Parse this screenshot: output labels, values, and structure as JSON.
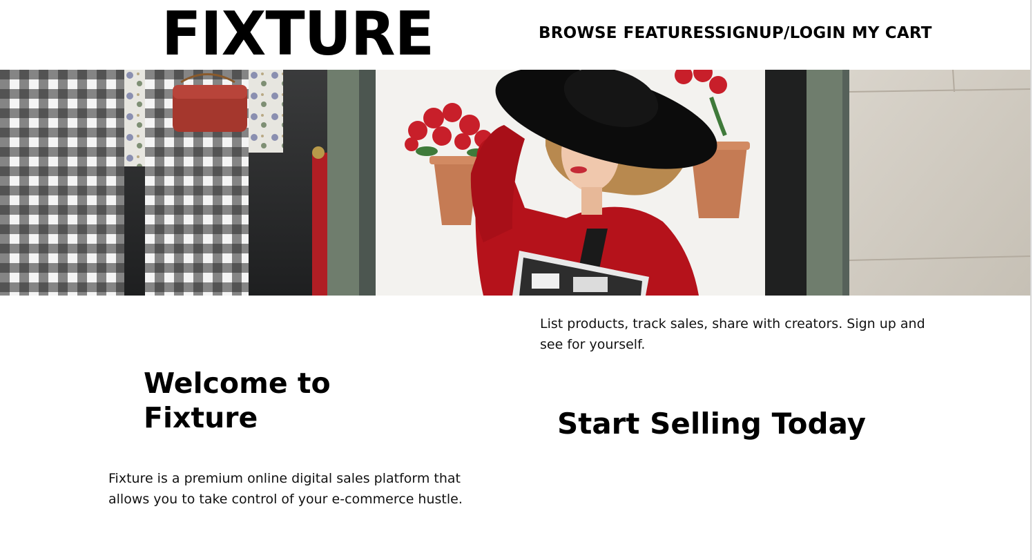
{
  "brand": {
    "logo_text": "FIXTURE"
  },
  "nav": {
    "items": [
      {
        "label": "BROWSE"
      },
      {
        "label": "FEATURESSIGNUP/LOGIN"
      },
      {
        "label": "MY CART"
      }
    ]
  },
  "hero": {
    "image_subject": "woman-in-red-coat-and-black-hat-storefront",
    "colors": {
      "coat": "#b5121b",
      "hat": "#0c0c0c",
      "wall": "#f3f2ef",
      "frame": "#6f7d6d"
    }
  },
  "main": {
    "tagline": "List products, track sales, share with creators. Sign up and see for yourself.",
    "welcome_heading": "Welcome to Fixture",
    "start_heading": "Start Selling Today",
    "description": "Fixture is a premium online digital sales platform that allows you to take control of your e-commerce hustle."
  }
}
